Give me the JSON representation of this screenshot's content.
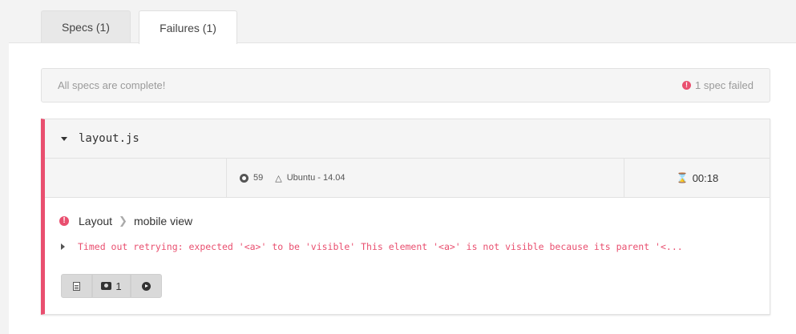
{
  "tabs": [
    {
      "label": "Specs (1)",
      "active": false
    },
    {
      "label": "Failures (1)",
      "active": true
    }
  ],
  "status": {
    "message": "All specs are complete!",
    "failed_label": "1 spec failed",
    "failed_icon": "exclamation-circle-icon"
  },
  "spec": {
    "file": "layout.js",
    "browser_icon": "chrome-icon",
    "browser_version": "59",
    "os_icon": "linux-icon",
    "os": "Ubuntu - 14.04",
    "duration_icon": "hourglass-icon",
    "duration": "00:18"
  },
  "test": {
    "suite": "Layout",
    "name": "mobile view",
    "error": "Timed out retrying: expected '<a>' to be 'visible' This element '<a>' is not visible because its parent '<...",
    "screenshots_count": "1"
  },
  "colors": {
    "failure_accent": "#e94f6f",
    "panel_bg": "#f5f5f5"
  }
}
